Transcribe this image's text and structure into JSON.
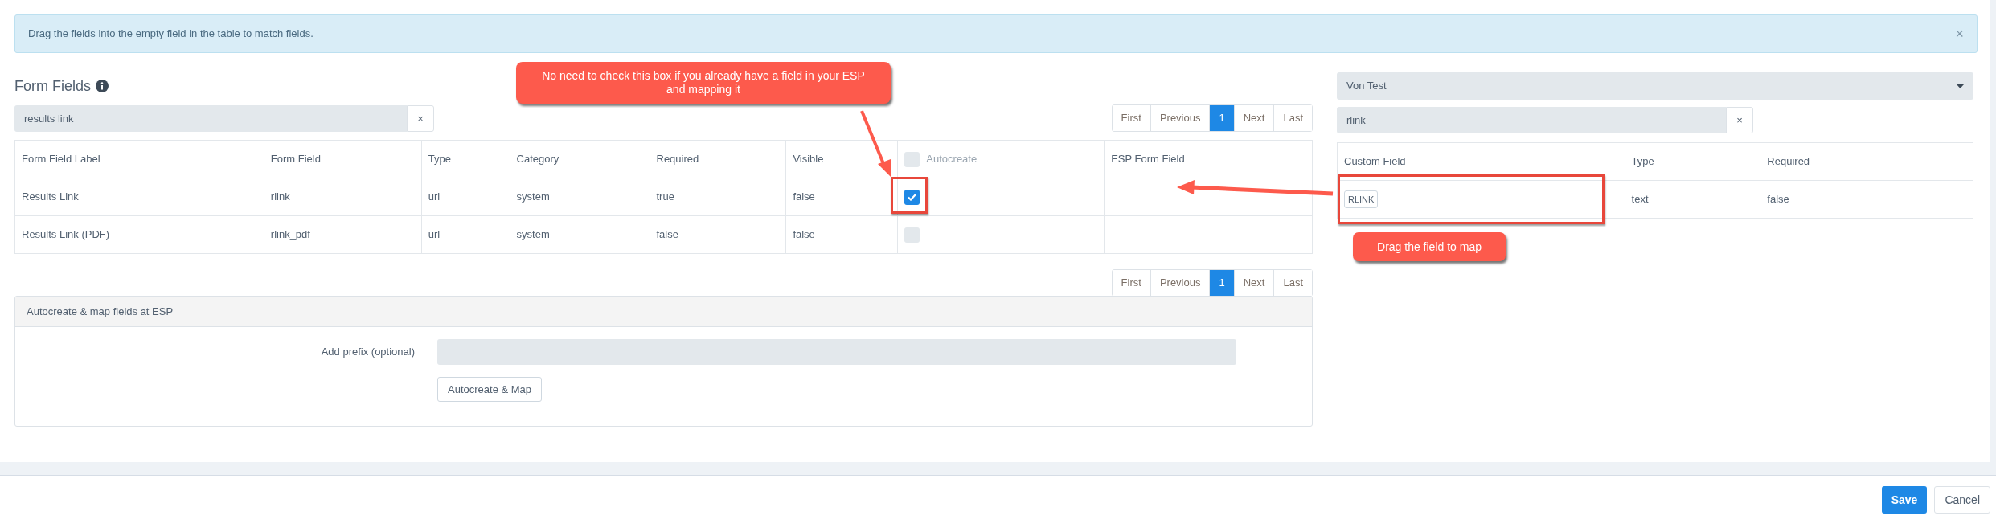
{
  "alert": {
    "text": "Drag the fields into the empty field in the table to match fields.",
    "close": "×"
  },
  "form_fields": {
    "title": "Form Fields",
    "search": {
      "value": "results link",
      "clear": "×"
    },
    "pagination_top": [
      {
        "label": "First",
        "selected": false
      },
      {
        "label": "Previous",
        "selected": false
      },
      {
        "label": "1",
        "selected": true
      },
      {
        "label": "Next",
        "selected": false
      },
      {
        "label": "Last",
        "selected": false
      }
    ],
    "table": {
      "columns": [
        "Form Field Label",
        "Form Field",
        "Type",
        "Category",
        "Required",
        "Visible",
        "Autocreate",
        "ESP Form Field"
      ],
      "header_checkbox_checked": false,
      "rows": [
        {
          "label": "Results Link",
          "field": "rlink",
          "type": "url",
          "category": "system",
          "required": "true",
          "visible": "false",
          "autocreate": true
        },
        {
          "label": "Results Link (PDF)",
          "field": "rlink_pdf",
          "type": "url",
          "category": "system",
          "required": "false",
          "visible": "false",
          "autocreate": false
        }
      ]
    },
    "pagination_bottom": [
      {
        "label": "First",
        "selected": false
      },
      {
        "label": "Previous",
        "selected": false
      },
      {
        "label": "1",
        "selected": true
      },
      {
        "label": "Next",
        "selected": false
      },
      {
        "label": "Last",
        "selected": false
      }
    ]
  },
  "autocreate_panel": {
    "title": "Autocreate & map fields at ESP",
    "prefix_label": "Add prefix (optional)",
    "button": "Autocreate & Map"
  },
  "custom_fields": {
    "select": "Von Test",
    "search": {
      "value": "rlink",
      "clear": "×"
    },
    "table": {
      "columns": [
        "Custom Field",
        "Type",
        "Required"
      ],
      "rows": [
        {
          "custom_field": "RLINK",
          "type": "text",
          "required": "false"
        }
      ]
    }
  },
  "annotations": {
    "check_hint": "No need to check this box if you already have a field in your ESP and mapping it",
    "drag_hint": "Drag the field to map"
  },
  "footer": {
    "buttons": [
      {
        "label": "Save",
        "kind": "primary"
      },
      {
        "label": "Cancel",
        "kind": "default"
      }
    ]
  }
}
